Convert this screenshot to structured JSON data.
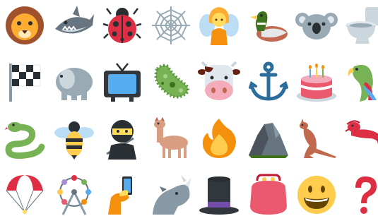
{
  "emojis": [
    "lion-face",
    "shark",
    "lady-beetle",
    "spider-web",
    "fairy",
    "duck",
    "koala",
    "toilet",
    "chequered-flag",
    "elephant",
    "television",
    "microbe",
    "cow-face",
    "anchor",
    "birthday-cake",
    "parrot",
    "snake",
    "honeybee",
    "ninja",
    "llama",
    "fire",
    "rock",
    "kangaroo",
    "lobster",
    "parachute",
    "ferris-wheel",
    "selfie",
    "rhinoceros",
    "top-hat",
    "purse",
    "grinning-face",
    "red-question-mark"
  ],
  "colors": {
    "background": "#ffffff",
    "lion": "#d99e3a",
    "mane": "#a0522d",
    "shark": "#66757f",
    "ladybug": "#dd2e44",
    "fire": "#f4900c",
    "snake": "#77b255",
    "cow": "#f3f3f3",
    "anchor": "#2b6d9b",
    "cake": "#ea596e",
    "purse": "#ea596e",
    "question": "#dd2e44",
    "smile": "#ffcc4d",
    "tv": "#55acee"
  }
}
